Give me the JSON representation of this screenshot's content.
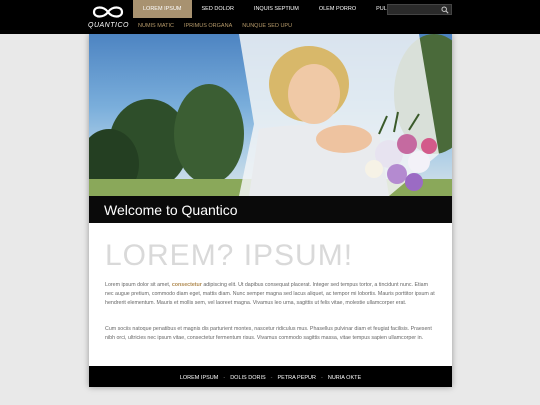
{
  "brand": {
    "name": "QUANTICO"
  },
  "nav": {
    "items": [
      {
        "label": "LOREM IPSUM",
        "active": true
      },
      {
        "label": "SED DOLOR"
      },
      {
        "label": "INQUIS SEPTIUM"
      },
      {
        "label": "OLEM PORRO"
      },
      {
        "label": "PULLUS IMPOUS"
      }
    ],
    "subitems": [
      {
        "label": "NUMIS MATIC"
      },
      {
        "label": "IPRIMUS ORGANA"
      },
      {
        "label": "NUNQUE SED UPU"
      }
    ]
  },
  "search": {
    "placeholder": ""
  },
  "hero": {
    "welcome": "Welcome to Quantico"
  },
  "main": {
    "headline": "LOREM? IPSUM!",
    "para1_a": "Lorem ipsum dolor sit amet, ",
    "para1_link": "consectetur",
    "para1_b": " adipiscing elit. Ut dapibus consequat placerat. Integer sed tempus tortor, a tincidunt nunc. Etiam nec augue pretium, commodo diam eget, mattis diam. Nunc semper magna sed lacus aliquet, ac tempor mi lobortis. Mauris porttitor ipsum at hendrerit elementum. Mauris et mollis sem, vel laoreet magna. Vivamus leo urna, sagittis ut felis vitae, molestie ullamcorper erat.",
    "para2": "Cum sociis natoque penatibus et magnis dis parturient montes, nascetur ridiculus mus. Phasellus pulvinar diam et feugiat facilisis. Praesent nibh orci, ultricies nec ipsum vitae, consectetur fermentum risus. Vivamus commodo sagittis massa, vitae tempus sapien ullamcorper in."
  },
  "footer": {
    "links": [
      "LOREM IPSUM",
      "DOLIS DORIS",
      "PETRA PEPUR",
      "NURIA OKTE"
    ]
  },
  "colors": {
    "accent": "#a89270",
    "link": "#b08a50",
    "bar": "#000000"
  }
}
